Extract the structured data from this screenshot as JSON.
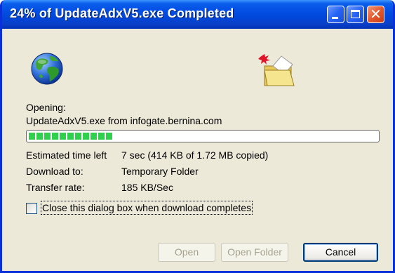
{
  "window": {
    "title": "24% of UpdateAdxV5.exe Completed"
  },
  "titlebar_buttons": {
    "close_glyph": "✕"
  },
  "status": {
    "opening_label": "Opening:",
    "file_source": "UpdateAdxV5.exe from infogate.bernina.com"
  },
  "progress": {
    "percent": 24
  },
  "details": {
    "time_left_label": "Estimated time left",
    "time_left_value": "7 sec (414 KB of 1.72 MB copied)",
    "download_to_label": "Download to:",
    "download_to_value": "Temporary Folder",
    "transfer_rate_label": "Transfer rate:",
    "transfer_rate_value": "185 KB/Sec"
  },
  "options": {
    "close_when_done_label": "Close this dialog box when download completes",
    "close_when_done_checked": false
  },
  "buttons": {
    "open_label": "Open",
    "open_folder_label": "Open Folder",
    "cancel_label": "Cancel"
  },
  "icons": {
    "globe": "globe-icon",
    "folder": "folder-icon"
  }
}
